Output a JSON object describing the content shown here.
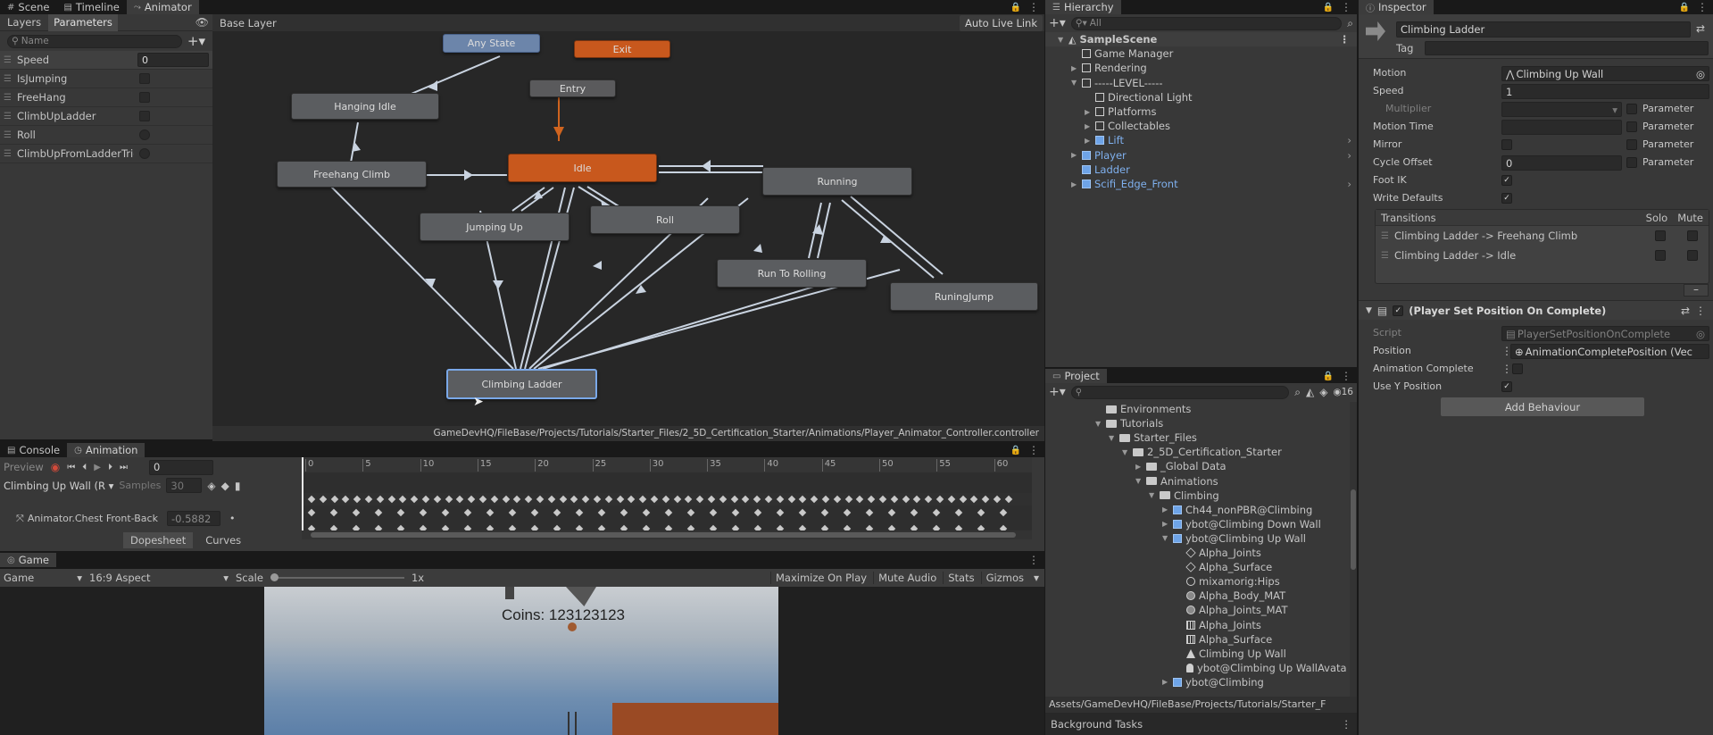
{
  "top_tabs": {
    "scene": "Scene",
    "timeline": "Timeline",
    "animator": "Animator"
  },
  "animator": {
    "left_tabs": {
      "layers": "Layers",
      "parameters": "Parameters"
    },
    "search_placeholder": "Name",
    "layer_name": "Base Layer",
    "live_link": "Auto Live Link",
    "params": [
      {
        "name": "Speed",
        "type": "float",
        "value": "0"
      },
      {
        "name": "IsJumping",
        "type": "bool"
      },
      {
        "name": "FreeHang",
        "type": "bool"
      },
      {
        "name": "ClimbUpLadder",
        "type": "bool"
      },
      {
        "name": "Roll",
        "type": "trigger"
      },
      {
        "name": "ClimbUpFromLadderTrigg",
        "type": "trigger"
      }
    ],
    "states": {
      "any_state": "Any State",
      "exit": "Exit",
      "entry": "Entry",
      "hanging_idle": "Hanging Idle",
      "freehang_climb": "Freehang Climb",
      "idle": "Idle",
      "running": "Running",
      "jumping_up": "Jumping Up",
      "roll": "Roll",
      "run_to_rolling": "Run To Rolling",
      "runing_jump": "RuningJump",
      "climbing_ladder": "Climbing Ladder"
    },
    "path": "GameDevHQ/FileBase/Projects/Tutorials/Starter_Files/2_5D_Certification_Starter/Animations/Player_Animator_Controller.controller"
  },
  "animation": {
    "tabs": {
      "console": "Console",
      "animation": "Animation"
    },
    "preview": "Preview",
    "frame": "0",
    "clip": "Climbing Up Wall (R",
    "samples_label": "Samples",
    "samples": "30",
    "property": "Animator.Chest Front-Back",
    "property_value": "-0.5882",
    "dopesheet": "Dopesheet",
    "curves": "Curves",
    "ticks": [
      "0",
      "5",
      "10",
      "15",
      "20",
      "25",
      "30",
      "35",
      "40",
      "45",
      "50",
      "55",
      "60"
    ]
  },
  "game": {
    "tab": "Game",
    "display": "Game",
    "aspect": "16:9 Aspect",
    "scale_label": "Scale",
    "scale_value": "1x",
    "buttons": [
      "Maximize On Play",
      "Mute Audio",
      "Stats",
      "Gizmos"
    ],
    "coins": "Coins: 123123123"
  },
  "hierarchy": {
    "tab": "Hierarchy",
    "search": "All",
    "items": [
      {
        "label": "SampleScene",
        "depth": 0,
        "icon": "unity-scene-icon",
        "arrow": "▼",
        "bold": true
      },
      {
        "label": "Game Manager",
        "depth": 1,
        "icon": "cube-icon",
        "arrow": ""
      },
      {
        "label": "Rendering",
        "depth": 1,
        "icon": "cube-icon",
        "arrow": "▶"
      },
      {
        "label": "-----LEVEL-----",
        "depth": 1,
        "icon": "cube-icon",
        "arrow": "▼"
      },
      {
        "label": "Directional Light",
        "depth": 2,
        "icon": "cube-icon",
        "arrow": ""
      },
      {
        "label": "Platforms",
        "depth": 2,
        "icon": "cube-icon",
        "arrow": "▶"
      },
      {
        "label": "Collectables",
        "depth": 2,
        "icon": "cube-icon",
        "arrow": "▶"
      },
      {
        "label": "Lift",
        "depth": 2,
        "icon": "prefab-icon",
        "arrow": "▶",
        "blue": true
      },
      {
        "label": "Player",
        "depth": 1,
        "icon": "prefab-icon",
        "arrow": "▶",
        "blue": true
      },
      {
        "label": "Ladder",
        "depth": 1,
        "icon": "prefab-icon",
        "arrow": "",
        "blue": true
      },
      {
        "label": "Scifi_Edge_Front",
        "depth": 1,
        "icon": "prefab-icon",
        "arrow": "▶",
        "blue": true
      }
    ]
  },
  "project": {
    "tab": "Project",
    "count": "16",
    "items": [
      {
        "label": "Environments",
        "depth": 0,
        "icon": "folder-icon"
      },
      {
        "label": "Tutorials",
        "depth": 0,
        "icon": "folder-icon",
        "arrow": "▼"
      },
      {
        "label": "Starter_Files",
        "depth": 1,
        "icon": "folder-icon",
        "arrow": "▼"
      },
      {
        "label": "2_5D_Certification_Starter",
        "depth": 2,
        "icon": "folder-icon",
        "arrow": "▼"
      },
      {
        "label": "_Global Data",
        "depth": 3,
        "icon": "folder-icon",
        "arrow": "▶"
      },
      {
        "label": "Animations",
        "depth": 3,
        "icon": "folder-icon",
        "arrow": "▼"
      },
      {
        "label": "Climbing",
        "depth": 4,
        "icon": "folder-icon",
        "arrow": "▼"
      },
      {
        "label": "Ch44_nonPBR@Climbing",
        "depth": 5,
        "icon": "model-icon",
        "arrow": "▶"
      },
      {
        "label": "ybot@Climbing Down Wall",
        "depth": 5,
        "icon": "model-icon",
        "arrow": "▶"
      },
      {
        "label": "ybot@Climbing Up Wall",
        "depth": 5,
        "icon": "model-icon",
        "arrow": "▼"
      },
      {
        "label": "Alpha_Joints",
        "depth": 6,
        "icon": "mesh-icon"
      },
      {
        "label": "Alpha_Surface",
        "depth": 6,
        "icon": "mesh-icon"
      },
      {
        "label": "mixamorig:Hips",
        "depth": 6,
        "icon": "transform-icon"
      },
      {
        "label": "Alpha_Body_MAT",
        "depth": 6,
        "icon": "material-icon"
      },
      {
        "label": "Alpha_Joints_MAT",
        "depth": 6,
        "icon": "material-icon"
      },
      {
        "label": "Alpha_Joints",
        "depth": 6,
        "icon": "grid-icon"
      },
      {
        "label": "Alpha_Surface",
        "depth": 6,
        "icon": "grid-icon"
      },
      {
        "label": "Climbing Up Wall",
        "depth": 6,
        "icon": "anim-clip-icon"
      },
      {
        "label": "ybot@Climbing Up WallAvata",
        "depth": 6,
        "icon": "avatar-icon"
      },
      {
        "label": "ybot@Climbing",
        "depth": 5,
        "icon": "model-icon",
        "arrow": "▶"
      }
    ],
    "path": "Assets/GameDevHQ/FileBase/Projects/Tutorials/Starter_F",
    "background_tasks": "Background Tasks"
  },
  "inspector": {
    "tab": "Inspector",
    "name": "Climbing Ladder",
    "tag_label": "Tag",
    "rows": {
      "motion_label": "Motion",
      "motion_value": "Climbing Up Wall",
      "speed_label": "Speed",
      "speed_value": "1",
      "multiplier_label": "Multiplier",
      "motion_time_label": "Motion Time",
      "mirror_label": "Mirror",
      "cycle_offset_label": "Cycle Offset",
      "cycle_offset_value": "0",
      "foot_ik_label": "Foot IK",
      "write_defaults_label": "Write Defaults",
      "parameter": "Parameter"
    },
    "transitions": {
      "label": "Transitions",
      "solo": "Solo",
      "mute": "Mute",
      "items": [
        "Climbing Ladder -> Freehang Climb",
        "Climbing Ladder -> Idle"
      ]
    },
    "behaviour": {
      "title": "(Player Set Position On Complete)",
      "script_label": "Script",
      "script_value": "PlayerSetPositionOnComplete",
      "position_label": "Position",
      "position_value": "AnimationCompletePosition (Vec",
      "anim_complete_label": "Animation Complete",
      "use_y_label": "Use Y Position"
    },
    "add_behaviour": "Add Behaviour"
  }
}
